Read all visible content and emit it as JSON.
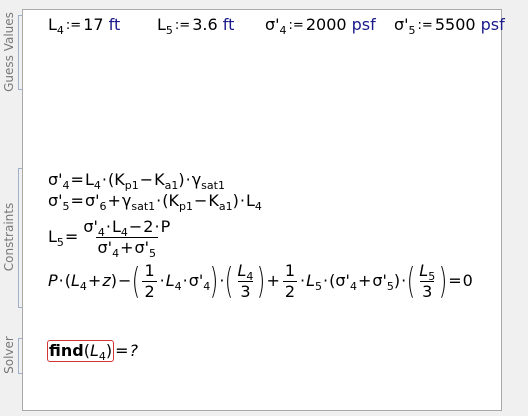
{
  "sections": {
    "guess_label": "Guess Values",
    "constraints_label": "Constraints",
    "solver_label": "Solver"
  },
  "operators": {
    "define": ":=",
    "equals": "=",
    "times": "·",
    "minus": "−",
    "plus": "+",
    "lparen": "(",
    "rparen": ")"
  },
  "guess": {
    "l4": {
      "sym": "L",
      "sub": "4",
      "value": "17",
      "unit": "ft"
    },
    "l5": {
      "sym": "L",
      "sub": "5",
      "value": "3.6",
      "unit": "ft"
    },
    "s4": {
      "sym": "σ'",
      "sub": "4",
      "value": "2000",
      "unit": "psf"
    },
    "s5": {
      "sym": "σ'",
      "sub": "5",
      "value": "5500",
      "unit": "psf"
    }
  },
  "vars": {
    "L": "L",
    "sigma": "σ'",
    "K": "K",
    "gamma": "γ",
    "P": "P",
    "z": "z",
    "s4": "4",
    "s5": "5",
    "s6": "6",
    "p1": "p1",
    "a1": "a1",
    "sat1": "sat1"
  },
  "numbers": {
    "one": "1",
    "two": "2",
    "three": "3",
    "zero": "0"
  },
  "solver": {
    "func": "find",
    "arg": "L",
    "arg_sub": "4",
    "result": "?"
  },
  "colors": {
    "unit": "#1a1a8c",
    "find_border": "#d43535",
    "bracket": "#9fb0c8",
    "label": "#787878"
  }
}
